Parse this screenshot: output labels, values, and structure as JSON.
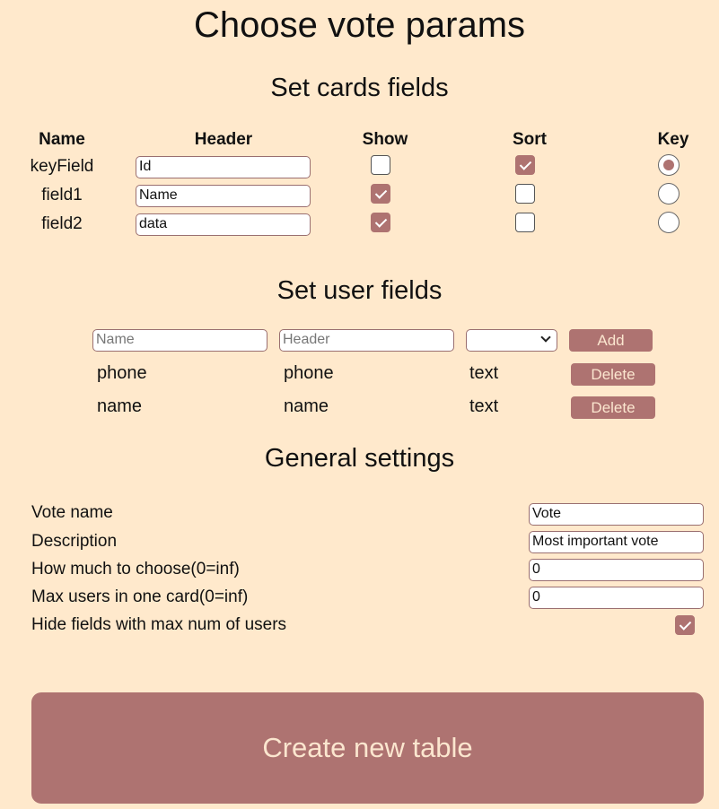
{
  "title": "Choose vote params",
  "cards_section": {
    "title": "Set cards fields",
    "columns": {
      "name": "Name",
      "header": "Header",
      "show": "Show",
      "sort": "Sort",
      "key": "Key"
    },
    "rows": [
      {
        "name": "keyField",
        "header": "Id",
        "show": false,
        "sort": true,
        "key": true
      },
      {
        "name": "field1",
        "header": "Name",
        "show": true,
        "sort": false,
        "key": false
      },
      {
        "name": "field2",
        "header": "data",
        "show": true,
        "sort": false,
        "key": false
      }
    ]
  },
  "user_section": {
    "title": "Set user fields",
    "name_placeholder": "Name",
    "header_placeholder": "Header",
    "type_value": "",
    "add_label": "Add",
    "delete_label": "Delete",
    "fields": [
      {
        "name": "phone",
        "header": "phone",
        "type": "text"
      },
      {
        "name": "name",
        "header": "name",
        "type": "text"
      }
    ]
  },
  "general_section": {
    "title": "General settings",
    "vote_name_label": "Vote name",
    "vote_name_value": "Vote",
    "description_label": "Description",
    "description_value": "Most important vote",
    "choose_label": "How much to choose(0=inf)",
    "choose_value": "0",
    "max_users_label": "Max users in one card(0=inf)",
    "max_users_value": "0",
    "hide_label": "Hide fields with max num of users",
    "hide_checked": true
  },
  "create_button_label": "Create new table",
  "colors": {
    "background": "#ffe9cc",
    "accent": "#ae7371",
    "button_text": "#fbe6cf"
  }
}
